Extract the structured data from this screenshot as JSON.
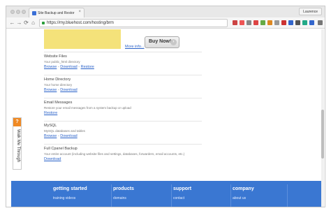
{
  "browser": {
    "tab_title": "Site Backup and Restor",
    "tab_close": "×",
    "profile_name": "Laurence",
    "url": "https://my.bluehost.com/hosting/brm",
    "nav": {
      "back": "←",
      "forward": "→",
      "reload": "⟳",
      "home": "⌂"
    }
  },
  "promo": {
    "more_info": "More info...",
    "buy_now": "Buy Now!",
    "buy_now_arrow": "›"
  },
  "sections": [
    {
      "title": "Website Files",
      "desc": "Your public_html directory",
      "links": [
        "Browse",
        "Download",
        "Restore"
      ]
    },
    {
      "title": "Home Directory",
      "desc": "Your home directory",
      "links": [
        "Browse",
        "Download"
      ]
    },
    {
      "title": "Email Messages",
      "desc": "Restore your email messages from a system backup or upload",
      "links": [
        "Restore"
      ]
    },
    {
      "title": "MySQL",
      "desc": "MySQL databases and tables",
      "links": [
        "Browse",
        "Download"
      ]
    },
    {
      "title": "Full Cpanel Backup",
      "desc": "Your entire account (including website files and settings, databases, forwarders, email accounts, etc.)",
      "links": [
        "Download"
      ]
    }
  ],
  "link_separator": " - ",
  "walk_me_through": {
    "icon": "?",
    "label": "Walk Me Through"
  },
  "footer": [
    {
      "heading": "getting started",
      "link": "training videos"
    },
    {
      "heading": "products",
      "link": "domains"
    },
    {
      "heading": "support",
      "link": "contact"
    },
    {
      "heading": "company",
      "link": "about us"
    }
  ],
  "colors": {
    "footer_bg": "#3a77d2",
    "link": "#2a62c9",
    "help_tab": "#f08a24",
    "promo_banner": "#f4e27a"
  },
  "icons": [
    "lock-icon",
    "question-icon",
    "close-icon"
  ]
}
